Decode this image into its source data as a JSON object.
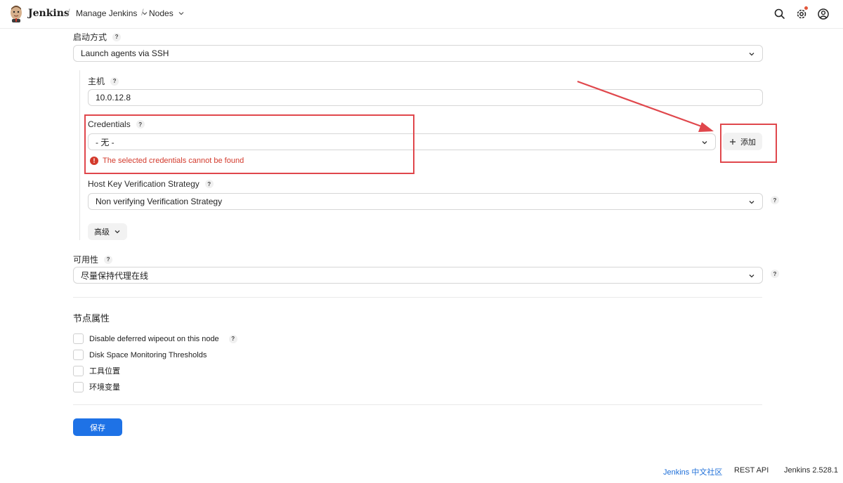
{
  "header": {
    "brand": "Jenkins",
    "breadcrumbs": [
      {
        "label": "Manage Jenkins"
      },
      {
        "label": "Nodes"
      }
    ],
    "icons": [
      "search-icon",
      "gear-icon",
      "user-icon"
    ]
  },
  "form": {
    "launch_method": {
      "label": "启动方式",
      "value": "Launch agents via SSH"
    },
    "host": {
      "label": "主机",
      "value": "10.0.12.8"
    },
    "credentials": {
      "label": "Credentials",
      "value": "- 无 -",
      "error": "The selected credentials cannot be found",
      "add_button": "添加"
    },
    "host_key": {
      "label": "Host Key Verification Strategy",
      "value": "Non verifying Verification Strategy"
    },
    "advanced_button": "高级",
    "availability": {
      "label": "可用性",
      "value": "尽量保持代理在线"
    },
    "help_glyph": "?"
  },
  "node_properties": {
    "title": "节点属性",
    "items": [
      {
        "label": "Disable deferred wipeout on this node"
      },
      {
        "label": "Disk Space Monitoring Thresholds"
      },
      {
        "label": "工具位置"
      },
      {
        "label": "环境变量"
      }
    ]
  },
  "save_button": "保存",
  "footer": {
    "community": "Jenkins 中文社区",
    "rest_api": "REST API",
    "version": "Jenkins 2.528.1"
  },
  "colors": {
    "accent": "#1e72e6",
    "error": "#d33a2c",
    "annotation": "#e0474c"
  }
}
